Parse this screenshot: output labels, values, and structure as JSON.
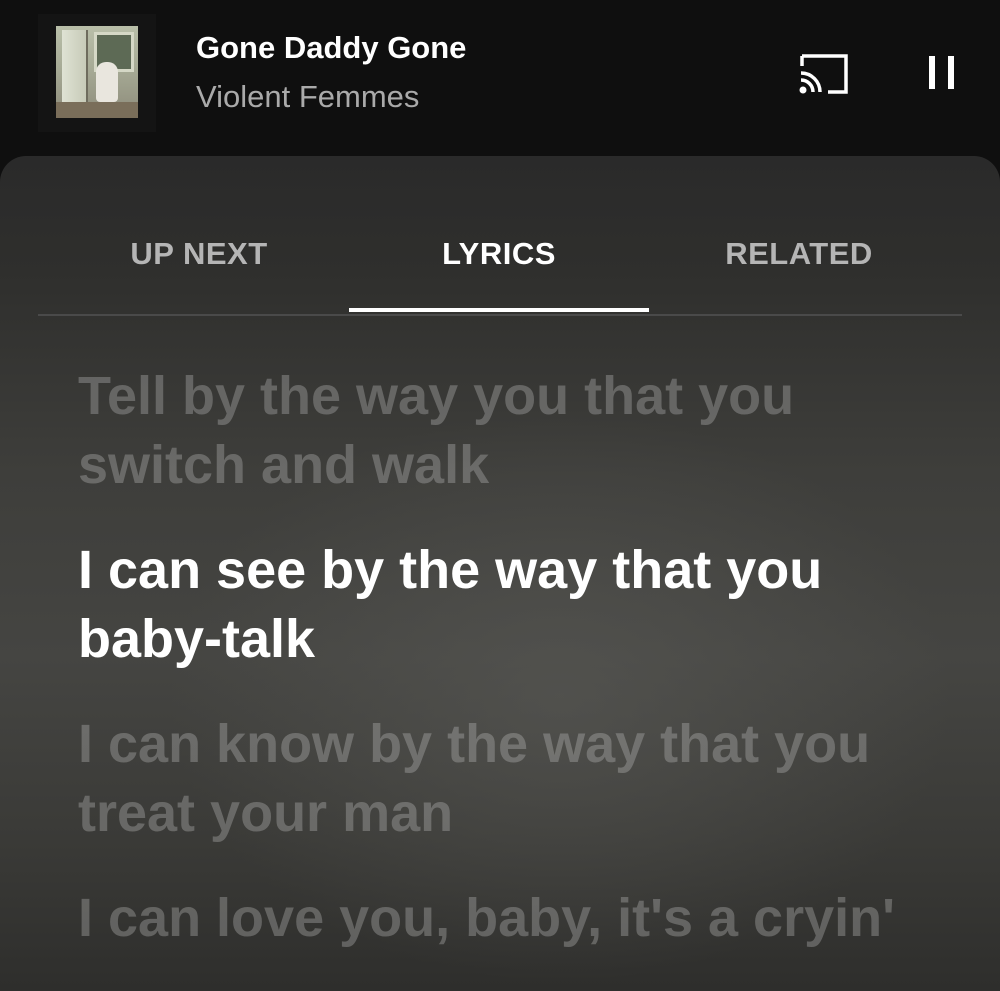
{
  "now_playing": {
    "title": "Gone Daddy Gone",
    "artist": "Violent Femmes",
    "album_art_icon": "album-cover-image"
  },
  "controls": {
    "cast_icon": "cast-icon",
    "pause_icon": "pause-icon"
  },
  "tabs": [
    {
      "label": "UP NEXT",
      "active": false
    },
    {
      "label": "LYRICS",
      "active": true
    },
    {
      "label": "RELATED",
      "active": false
    }
  ],
  "lyrics": [
    {
      "text": "Tell by the way you that you switch and walk",
      "current": false
    },
    {
      "text": "I can see by the way that you baby-talk",
      "current": true
    },
    {
      "text": "I can know by the way that you treat your man",
      "current": false
    },
    {
      "text": "I can love you, baby, it's a cryin'",
      "current": false
    }
  ],
  "colors": {
    "background": "#0f0f0f",
    "text_primary": "#ffffff",
    "text_secondary": "#aaaaaa",
    "lyric_inactive": "#6b6b6b"
  }
}
